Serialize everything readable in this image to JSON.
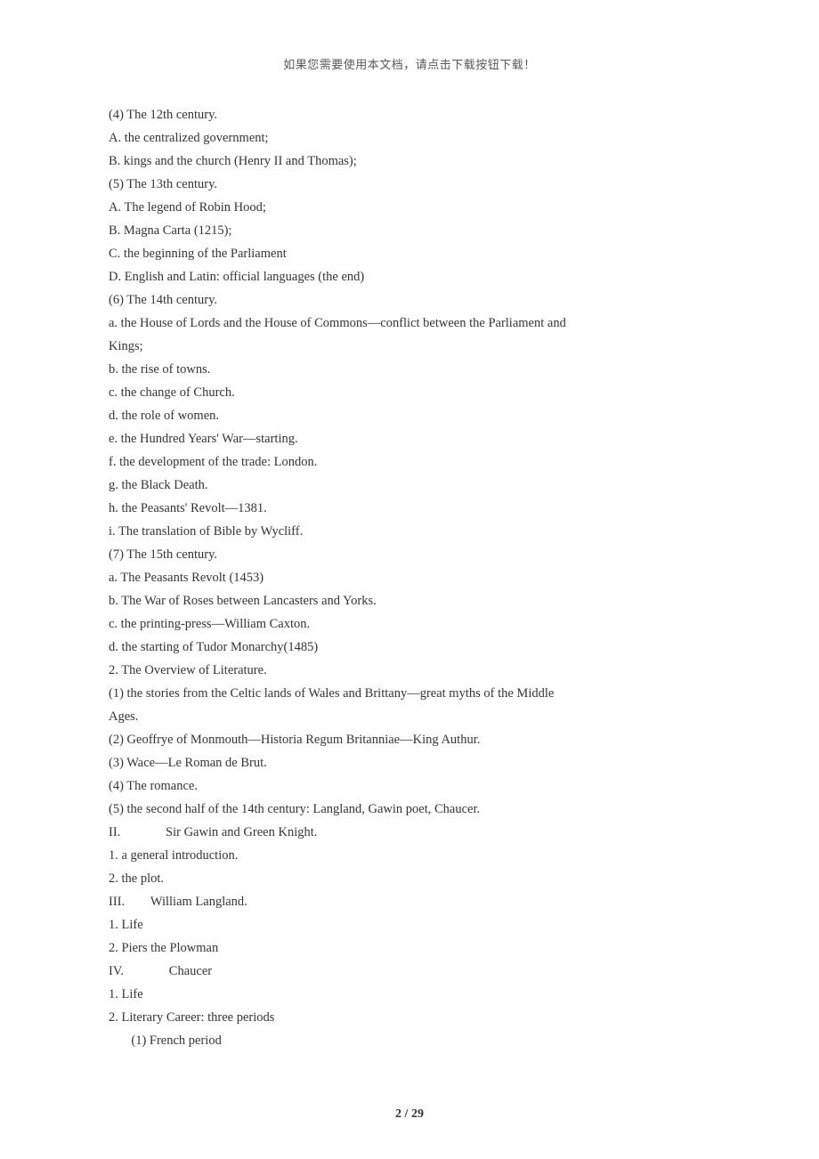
{
  "header": {
    "note": "如果您需要使用本文档，请点击下载按钮下载！"
  },
  "body": {
    "lines": [
      "(4) The 12th century.",
      "A. the centralized government;",
      "B. kings and the church (Henry II and Thomas);",
      "(5) The 13th century.",
      "A. The legend of Robin Hood;",
      "B. Magna Carta (1215);",
      "C. the beginning of the Parliament",
      "D. English and Latin: official languages (the end)",
      "(6) The 14th century.",
      "a. the House of Lords and the House of Commons—conflict between the Parliament and",
      "Kings;",
      "b. the rise of towns.",
      "c. the change of Church.",
      "d. the role of women.",
      "e. the Hundred Years' War—starting.",
      "f. the development of the trade: London.",
      "g. the Black Death.",
      "h. the Peasants' Revolt—1381.",
      "i. The translation of Bible by Wycliff.",
      "(7) The 15th century.",
      "a. The Peasants Revolt (1453)",
      "b. The War of Roses between Lancasters and Yorks.",
      "c. the printing-press—William Caxton.",
      "d. the starting of Tudor Monarchy(1485)",
      "2. The Overview of Literature.",
      "(1) the stories from the Celtic lands of Wales and Brittany—great myths of the Middle",
      "Ages.",
      "(2) Geoffrye of Monmouth—Historia Regum Britanniae—King Authur.",
      "(3) Wace—Le Roman de Brut.",
      "(4) The romance.",
      "(5) the second half of the 14th century: Langland, Gawin poet, Chaucer.",
      "",
      "II.              Sir Gawin and Green Knight.",
      "1. a general introduction.",
      "2. the plot.",
      "",
      "III.        William Langland.",
      "1. Life",
      "2. Piers the Plowman",
      "",
      "IV.              Chaucer",
      "1. Life",
      "2. Literary Career: three periods",
      "       (1) French period"
    ]
  },
  "footer": {
    "page_current": "2",
    "page_sep": " / ",
    "page_total": "29"
  }
}
